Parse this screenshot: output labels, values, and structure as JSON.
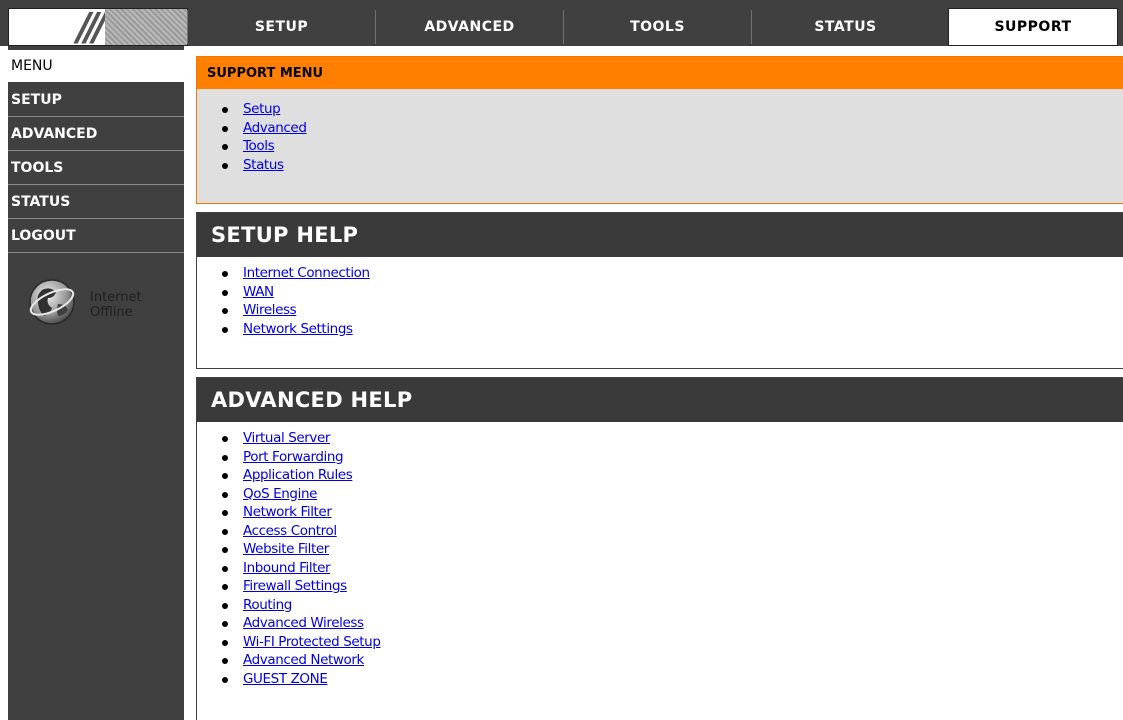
{
  "top_tabs": [
    "SETUP",
    "ADVANCED",
    "TOOLS",
    "STATUS",
    "SUPPORT"
  ],
  "active_top_tab": "SUPPORT",
  "sidebar": {
    "items": [
      "MENU",
      "SETUP",
      "ADVANCED",
      "TOOLS",
      "STATUS",
      "LOGOUT"
    ],
    "active": "MENU",
    "status_line1": "Internet",
    "status_line2": "Offline"
  },
  "support_menu": {
    "title": "SUPPORT MENU",
    "links": [
      "Setup",
      "Advanced",
      "Tools",
      "Status"
    ]
  },
  "setup_help": {
    "title": "SETUP HELP",
    "links": [
      "Internet Connection",
      "WAN",
      "Wireless",
      "Network Settings"
    ]
  },
  "advanced_help": {
    "title": "ADVANCED HELP",
    "links": [
      "Virtual Server",
      "Port Forwarding",
      "Application Rules",
      "QoS Engine",
      "Network Filter",
      "Access Control",
      "Website Filter",
      "Inbound Filter",
      "Firewall Settings",
      "Routing",
      "Advanced Wireless",
      "Wi-FI Protected Setup",
      "Advanced Network",
      "GUEST ZONE"
    ]
  },
  "colors": {
    "header_dark": "#404040",
    "support_orange": "#ff7f00",
    "support_bg": "#dfdfdf",
    "link_blue": "#0000dd"
  }
}
